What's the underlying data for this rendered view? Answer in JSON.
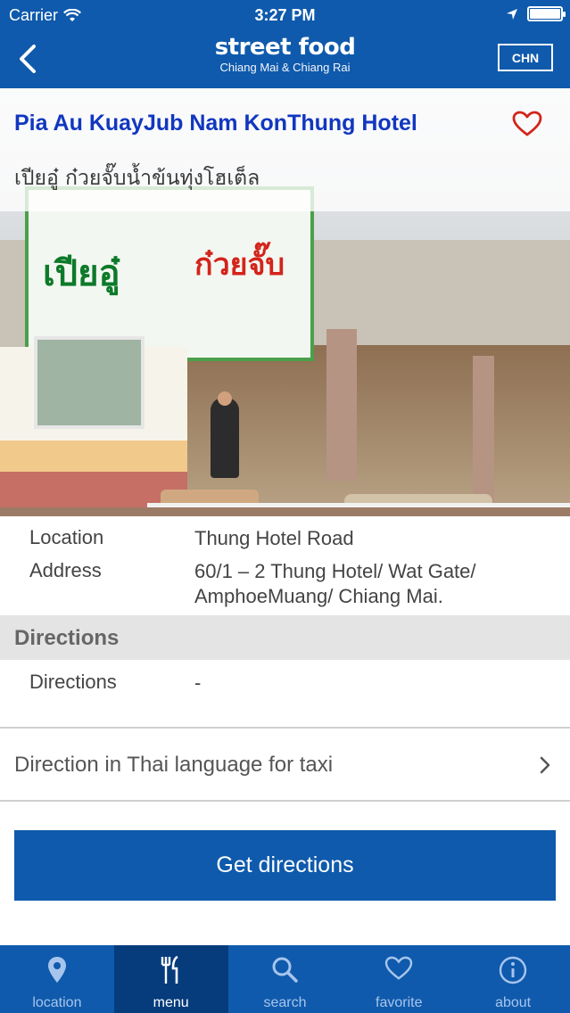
{
  "status_bar": {
    "carrier": "Carrier",
    "time": "3:27 PM",
    "battery_level": 1.0
  },
  "nav": {
    "logo_main": "street food",
    "logo_sub": "Chiang Mai & Chiang Rai",
    "language_button": "CHN"
  },
  "listing": {
    "title_en": "Pia Au KuayJub Nam KonThung Hotel",
    "title_th": "เปียอู๋ ก๋วยจั๊บน้ำข้นทุ่งโฮเต็ล",
    "photo_sign_line1": "เปียอู๋",
    "photo_sign_line2": "ก๋วยจั๊บ"
  },
  "details": {
    "location_label": "Location",
    "location_value": "Thung Hotel Road",
    "address_label": "Address",
    "address_value": "60/1 – 2 Thung Hotel/ Wat Gate/ AmphoeMuang/ Chiang Mai."
  },
  "directions_section": {
    "title": "Directions",
    "directions_label": "Directions",
    "directions_value": "-"
  },
  "taxi_row": {
    "label": "Direction in Thai language for taxi"
  },
  "get_directions_button": "Get directions",
  "tabs": [
    {
      "label": "location",
      "icon": "location-pin-icon"
    },
    {
      "label": "menu",
      "icon": "fork-knife-icon"
    },
    {
      "label": "search",
      "icon": "search-icon"
    },
    {
      "label": "favorite",
      "icon": "heart-icon"
    },
    {
      "label": "about",
      "icon": "info-icon"
    }
  ],
  "colors": {
    "brand_blue": "#0f5aac",
    "active_tab": "#063c7c",
    "title_blue": "#1137c0",
    "heart_red": "#d3241b"
  }
}
